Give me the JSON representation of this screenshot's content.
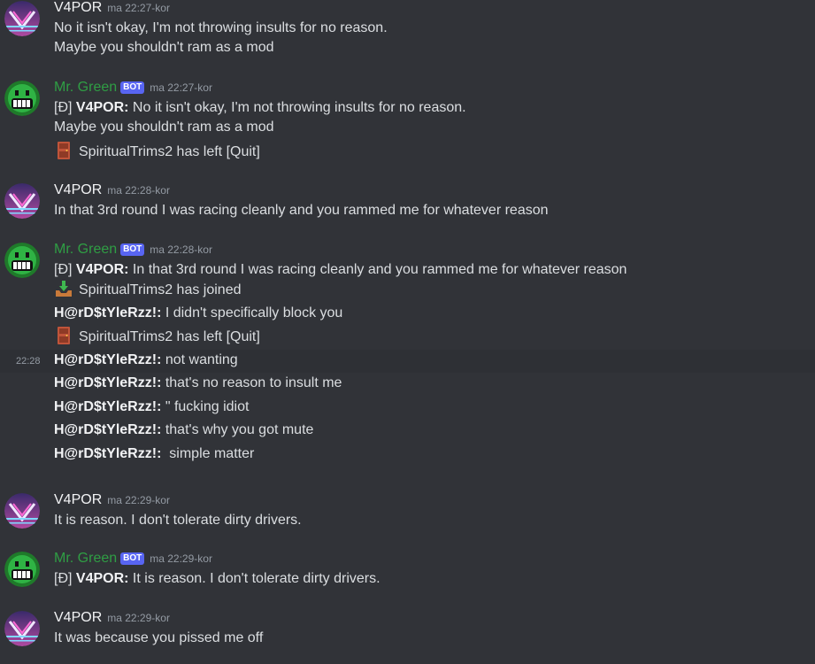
{
  "colors": {
    "background": "#313338",
    "bot_name": "#2f9e44",
    "bot_tag": "#5865f2",
    "timestamp": "#949ba4",
    "hover_row": "#2e3035"
  },
  "icons": {
    "door": "door-icon",
    "join": "inbox-tray-icon",
    "vapor_avatar": "synthwave-avatar",
    "bot_avatar": "green-grin-avatar"
  },
  "messages": [
    {
      "author": "V4POR",
      "timestamp": "ma 22:27-kor",
      "lines": [
        "No it isn't okay, I'm not throwing insults for no reason.",
        "Maybe you shouldn't ram as a mod"
      ]
    },
    {
      "author": "Mr. Green",
      "bot_tag": "BOT",
      "timestamp": "ma 22:27-kor",
      "lines": [
        {
          "prefix": "[Đ]",
          "bold": "V4POR:",
          "text": " No it isn't okay, I'm not throwing insults for no reason."
        },
        "Maybe you shouldn't ram as a mod",
        {
          "icon": "door",
          "text": "SpiritualTrims2 has left [Quit]"
        }
      ]
    },
    {
      "author": "V4POR",
      "timestamp": "ma 22:28-kor",
      "lines": [
        "In that 3rd round I was racing cleanly and you rammed me for whatever reason"
      ]
    },
    {
      "author": "Mr. Green",
      "bot_tag": "BOT",
      "timestamp": "ma 22:28-kor",
      "side_timestamp": "22:28",
      "lines": [
        {
          "prefix": "[Đ]",
          "bold": "V4POR:",
          "text": " In that 3rd round I was racing cleanly and you rammed me for whatever reason"
        },
        {
          "icon": "join",
          "text": "SpiritualTrims2 has joined"
        },
        {
          "bold": "H@rD$tYleRzz!:",
          "text": " I didn't specifically block you"
        },
        {
          "icon": "door",
          "text": "SpiritualTrims2 has left [Quit]"
        },
        {
          "bold": "H@rD$tYleRzz!:",
          "text": " not wanting"
        },
        {
          "bold": "H@rD$tYleRzz!:",
          "text": " that's no reason to insult me"
        },
        {
          "bold": "H@rD$tYleRzz!:",
          "text": " \" fucking idiot"
        },
        {
          "bold": "H@rD$tYleRzz!:",
          "text": " that's why you got mute"
        },
        {
          "bold": "H@rD$tYleRzz!:",
          "text": "  simple matter"
        }
      ]
    },
    {
      "author": "V4POR",
      "timestamp": "ma 22:29-kor",
      "lines": [
        "It is reason. I don't tolerate dirty drivers."
      ]
    },
    {
      "author": "Mr. Green",
      "bot_tag": "BOT",
      "timestamp": "ma 22:29-kor",
      "lines": [
        {
          "prefix": "[Đ]",
          "bold": "V4POR:",
          "text": " It is reason. I don't tolerate dirty drivers."
        }
      ]
    },
    {
      "author": "V4POR",
      "timestamp": "ma 22:29-kor",
      "lines": [
        "It was because you pissed me off"
      ]
    }
  ]
}
